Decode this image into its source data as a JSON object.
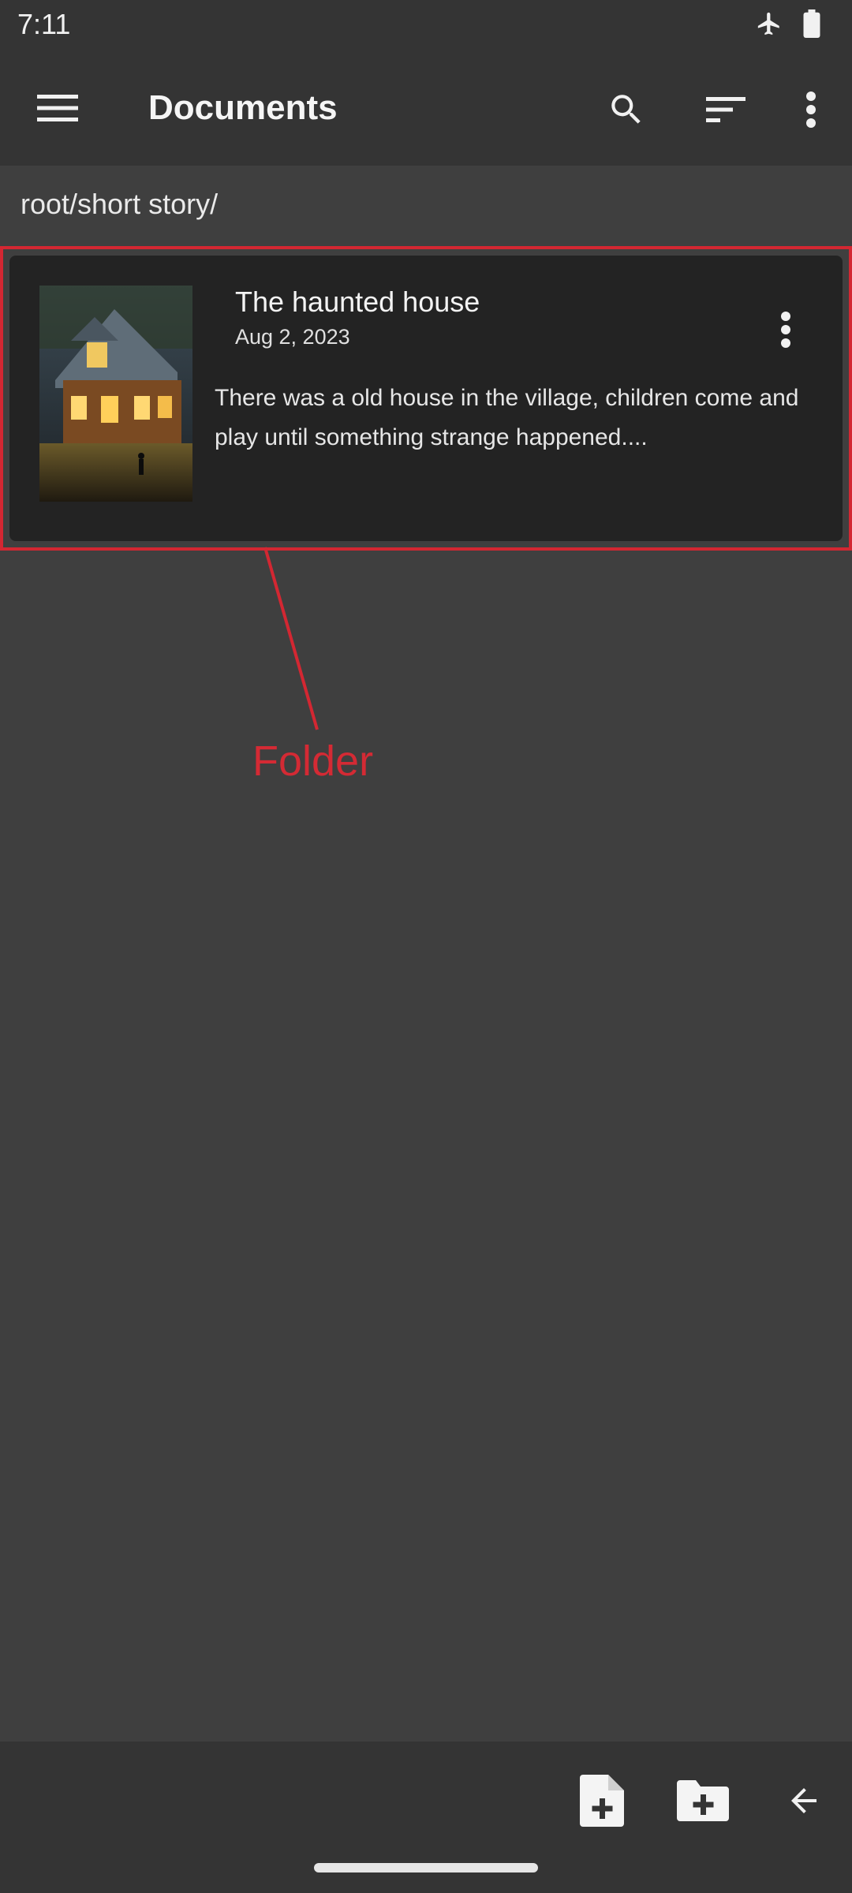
{
  "status_bar": {
    "time": "7:11",
    "icons": [
      "airplane-mode-icon",
      "battery-icon"
    ]
  },
  "app_bar": {
    "title": "Documents",
    "icons": [
      "menu-icon",
      "search-icon",
      "sort-icon",
      "more-vert-icon"
    ]
  },
  "breadcrumb": "root/short story/",
  "item": {
    "title": "The haunted house",
    "date": "Aug 2, 2023",
    "description": "There was a old house in the village, children come and play until something strange happened...."
  },
  "annotation": {
    "label": "Folder",
    "color": "#d32732"
  },
  "bottom_bar": {
    "icons": [
      "new-document-icon",
      "new-folder-icon",
      "back-arrow-icon"
    ]
  },
  "colors": {
    "background": "#3f3f3f",
    "bars": "#343434",
    "card": "#232323"
  }
}
